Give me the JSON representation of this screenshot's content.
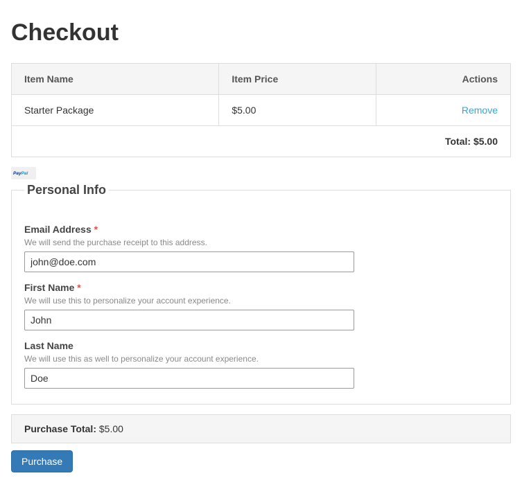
{
  "page": {
    "title": "Checkout"
  },
  "cart": {
    "columns": {
      "name": "Item Name",
      "price": "Item Price",
      "actions": "Actions"
    },
    "items": [
      {
        "name": "Starter Package",
        "price": "$5.00",
        "remove_label": "Remove"
      }
    ],
    "total_label": "Total:",
    "total_value": "$5.00"
  },
  "payment": {
    "paypal_badge": "PayPal"
  },
  "personal": {
    "legend": "Personal Info",
    "email": {
      "label": "Email Address",
      "required": "*",
      "help": "We will send the purchase receipt to this address.",
      "value": "john@doe.com"
    },
    "first": {
      "label": "First Name",
      "required": "*",
      "help": "We will use this to personalize your account experience.",
      "value": "John"
    },
    "last": {
      "label": "Last Name",
      "help": "We will use this as well to personalize your account experience.",
      "value": "Doe"
    }
  },
  "summary": {
    "label": "Purchase Total:",
    "value": "$5.00",
    "button": "Purchase"
  }
}
